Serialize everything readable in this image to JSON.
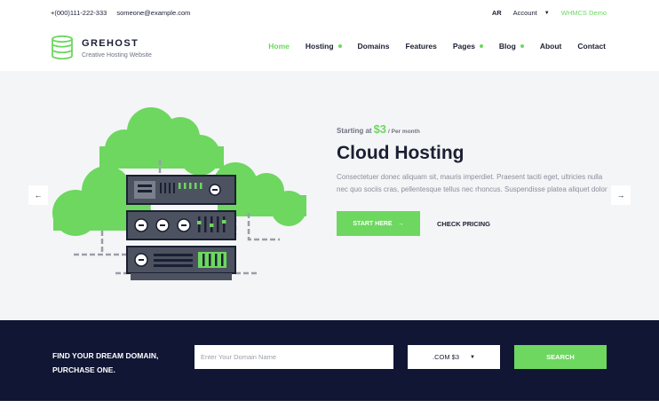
{
  "topbar": {
    "phone": "+(000)111-222-333",
    "email": "someone@example.com",
    "lang": "AR",
    "account": "Account",
    "demo": "WHMCS Demo"
  },
  "brand": {
    "name": "GREHOST",
    "tagline": "Creative Hosting Website"
  },
  "nav": {
    "items": [
      {
        "label": "Home"
      },
      {
        "label": "Hosting"
      },
      {
        "label": "Domains"
      },
      {
        "label": "Features"
      },
      {
        "label": "Pages"
      },
      {
        "label": "Blog"
      },
      {
        "label": "About"
      },
      {
        "label": "Contact"
      }
    ]
  },
  "hero": {
    "starting_label": "Starting at",
    "price": "$3",
    "per": "/ Per month",
    "title": "Cloud Hosting",
    "description": "Consectetuer donec aliquam sit, mauris imperdiet. Praesent taciti eget, ultricies nulla nec quo sociis cras, pellentesque tellus nec rhoncus. Suspendisse platea aliquet dolor",
    "start_button": "START HERE",
    "pricing_button": "CHECK PRICING"
  },
  "domain": {
    "title": "FIND YOUR DREAM DOMAIN, PURCHASE ONE.",
    "placeholder": "Enter Your Domain Name",
    "tld": ".COM $3",
    "search_button": "SEARCH"
  },
  "colors": {
    "accent": "#6dd760",
    "dark": "#101634",
    "hero_bg": "#f4f5f6"
  }
}
